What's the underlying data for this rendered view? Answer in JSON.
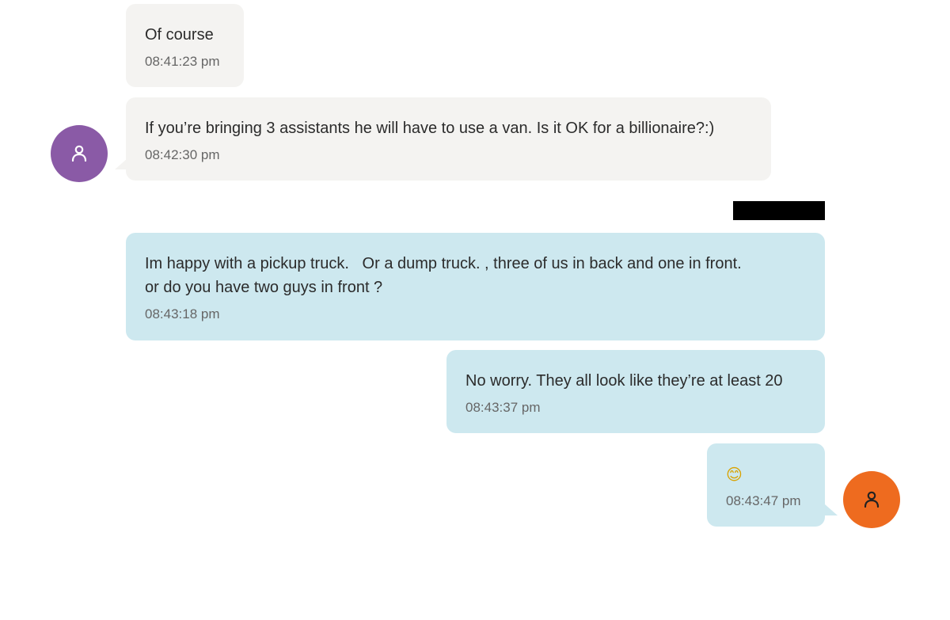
{
  "colors": {
    "incoming_bubble": "#f4f3f1",
    "outgoing_bubble": "#cde8ef",
    "contact_avatar": "#8a5aa6",
    "self_avatar": "#ee6b1f",
    "redaction": "#000000"
  },
  "messages": [
    {
      "direction": "incoming",
      "text": "Of course",
      "time": "08:41:23 pm"
    },
    {
      "direction": "incoming",
      "text": "If you’re bringing 3 assistants he will have to use a van. Is it OK for a billionaire?:)",
      "time": "08:42:30 pm"
    },
    {
      "direction": "outgoing",
      "text": "Im happy with a pickup truck.   Or a dump truck. , three of us in back and one in front.\nor do you have two guys in front ?",
      "time": "08:43:18 pm"
    },
    {
      "direction": "outgoing",
      "text": "No worry. They all look like they’re at least 20",
      "time": "08:43:37 pm"
    },
    {
      "direction": "outgoing",
      "text": "😊",
      "time": "08:43:47 pm"
    }
  ],
  "avatars": {
    "contact_icon": "user-icon",
    "self_icon": "user-icon"
  }
}
